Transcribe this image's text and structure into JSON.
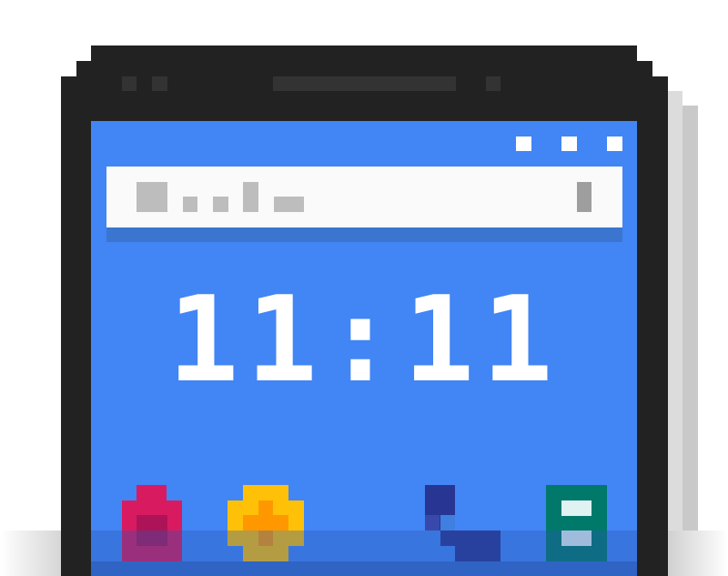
{
  "clock": {
    "time": "11:11"
  },
  "colors": {
    "screen": "#4285f4",
    "phone_body": "#222222",
    "search_bar": "#fafafa",
    "store_icon": "#d81b60",
    "contacts_icon": "#ffc107",
    "phone_icon": "#283593",
    "messages_icon": "#00796b"
  },
  "icons": {
    "status": [
      "status-dot-icon",
      "status-dot-icon",
      "status-dot-icon"
    ],
    "search": "google-logo-icon",
    "mic": "microphone-icon",
    "dock": [
      "shopping-bag-icon",
      "plus-badge-icon",
      "phone-handset-icon",
      "message-list-icon"
    ]
  }
}
